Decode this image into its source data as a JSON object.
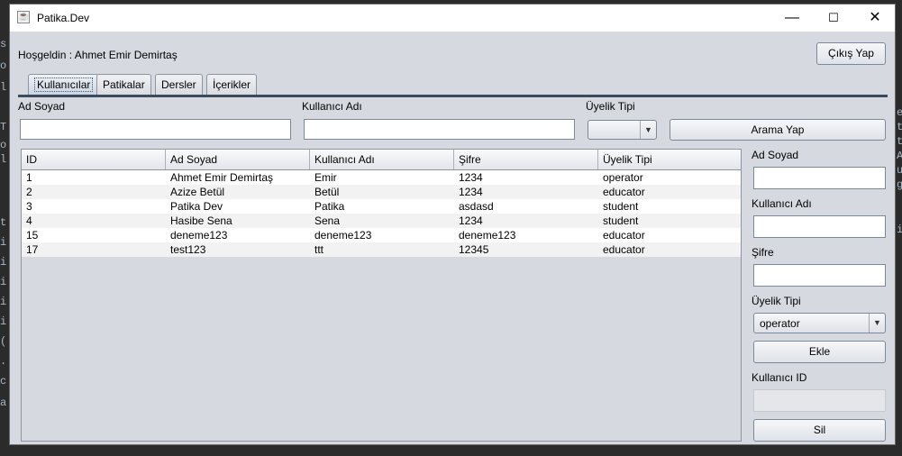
{
  "ide_left_chars": [
    "s",
    "o",
    "l",
    "T",
    "o",
    "l",
    "t",
    "i",
    "i",
    "i",
    "i",
    "i",
    "(",
    ".",
    "c",
    "a"
  ],
  "ide_right_chars": [
    "e",
    "t",
    "t",
    "A",
    "u",
    "g",
    "i"
  ],
  "window": {
    "title": "Patika.Dev",
    "app_icon": "java-icon",
    "minimize_glyph": "—",
    "maximize_glyph": "☐",
    "close_glyph": "✕"
  },
  "header": {
    "welcome": "Hoşgeldin : Ahmet Emir Demirtaş",
    "logout_label": "Çıkış Yap"
  },
  "tabs": [
    {
      "label": "Kullanıcılar",
      "active": true
    },
    {
      "label": "Patikalar"
    },
    {
      "label": "Dersler"
    },
    {
      "label": "İçerikler"
    }
  ],
  "search": {
    "name_label": "Ad Soyad",
    "name_value": "",
    "username_label": "Kullanıcı Adı",
    "username_value": "",
    "type_label": "Üyelik Tipi",
    "type_value": "",
    "button_label": "Arama Yap"
  },
  "table": {
    "columns": [
      "ID",
      "Ad Soyad",
      "Kullanıcı Adı",
      "Şifre",
      "Üyelik Tipi"
    ],
    "rows": [
      [
        "1",
        "Ahmet Emir Demirtaş",
        "Emir",
        "1234",
        "operator"
      ],
      [
        "2",
        "Azize Betül",
        "Betül",
        "1234",
        "educator"
      ],
      [
        "3",
        "Patika Dev",
        "Patika",
        "asdasd",
        "student"
      ],
      [
        "4",
        "Hasibe Sena",
        "Sena",
        "1234",
        "student"
      ],
      [
        "15",
        "deneme123",
        "deneme123",
        "deneme123",
        "educator"
      ],
      [
        "17",
        "test123",
        "ttt",
        "12345",
        "educator"
      ]
    ]
  },
  "form": {
    "name_label": "Ad Soyad",
    "name_value": "",
    "username_label": "Kullanıcı Adı",
    "username_value": "",
    "password_label": "Şifre",
    "password_value": "",
    "type_label": "Üyelik Tipi",
    "type_value": "operator",
    "add_label": "Ekle",
    "user_id_label": "Kullanıcı ID",
    "user_id_value": "",
    "delete_label": "Sil"
  },
  "colors": {
    "window_bg": "#d6d9df",
    "ide_bg": "#2b2b2b",
    "row_alt": "#f2f2f2"
  }
}
